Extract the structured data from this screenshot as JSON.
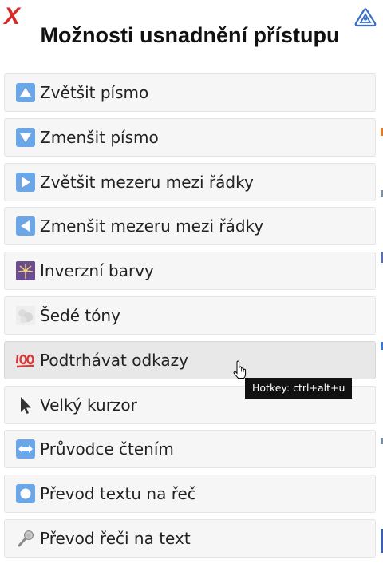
{
  "panel": {
    "close_label": "X",
    "title": "Možnosti usnadnění přístupu"
  },
  "menu": {
    "items": [
      {
        "label": "Zvětšit písmo",
        "icon": "arrow-up-box-icon"
      },
      {
        "label": "Zmenšit písmo",
        "icon": "arrow-down-box-icon"
      },
      {
        "label": "Zvětšit mezeru mezi řádky",
        "icon": "arrow-right-box-icon"
      },
      {
        "label": "Zmenšit mezeru mezi řádky",
        "icon": "arrow-left-box-icon"
      },
      {
        "label": "Inverzní barvy",
        "icon": "fireworks-icon"
      },
      {
        "label": "Šedé tóny",
        "icon": "fog-icon"
      },
      {
        "label": "Podtrhávat odkazy",
        "icon": "hundred-points-icon",
        "hovered": true
      },
      {
        "label": "Velký kurzor",
        "icon": "cursor-arrow-icon"
      },
      {
        "label": "Průvodce čtením",
        "icon": "left-right-arrow-box-icon"
      },
      {
        "label": "Převod textu na řeč",
        "icon": "record-button-icon"
      },
      {
        "label": "Převod řeči na text",
        "icon": "microphone-icon"
      }
    ]
  },
  "tooltip": {
    "text": "Hotkey: ctrl+alt+u"
  },
  "colors": {
    "close": "#d92a2a",
    "logo": "#3b6fc7",
    "item_bg": "#f6f6f6",
    "item_hover_bg": "#e8e8e8",
    "arrow_box": "#6aa6e8",
    "tooltip_bg": "#111111"
  }
}
